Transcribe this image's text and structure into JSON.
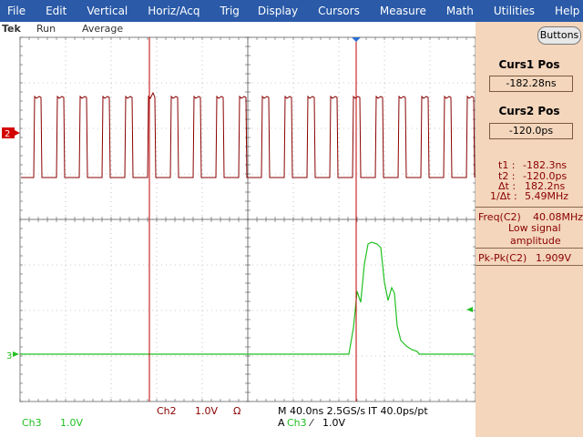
{
  "menu": [
    "File",
    "Edit",
    "Vertical",
    "Horiz/Acq",
    "Trig",
    "Display",
    "Cursors",
    "Measure",
    "Math",
    "Utilities",
    "Help"
  ],
  "status": {
    "brand": "Tek",
    "state": "Run",
    "mode": "Average"
  },
  "panel": {
    "buttons_label": "Buttons",
    "curs1_title": "Curs1 Pos",
    "curs1_value": "-182.28ns",
    "curs2_title": "Curs2 Pos",
    "curs2_value": "-120.0ps"
  },
  "readouts": {
    "t1_label": "t1 :",
    "t1": "-182.3ns",
    "t2_label": "t2 :",
    "t2": "-120.0ps",
    "dt_label": "Δt :",
    "dt": "182.2ns",
    "inv_label": "1/Δt :",
    "inv": "5.49MHz"
  },
  "measurements": {
    "freq_label": "Freq(C2)",
    "freq_value": "40.08MHz",
    "freq_note1": "Low signal",
    "freq_note2": "amplitude",
    "pk_label": "Pk-Pk(C2)",
    "pk_value": "1.909V"
  },
  "channels": {
    "ch2_marker": "2",
    "ch3_marker": "3"
  },
  "bottom": {
    "ch2": "Ch2",
    "ch2_scale": "1.0V",
    "ch2_term": "Ω",
    "ch3": "Ch3",
    "ch3_scale": "1.0V",
    "timebase": "M 40.0ns 2.5GS/s",
    "interp": "IT 40.0ps/pt",
    "trig_prefix": "A",
    "trig_src": "Ch3",
    "trig_slope": "⁄",
    "trig_level": "1.0V"
  },
  "colors": {
    "menu": "#2a5aa8",
    "ch2": "#8a0000",
    "ch3": "#22c022",
    "cursor": "#c00000",
    "panel": "#f3d6bc"
  }
}
